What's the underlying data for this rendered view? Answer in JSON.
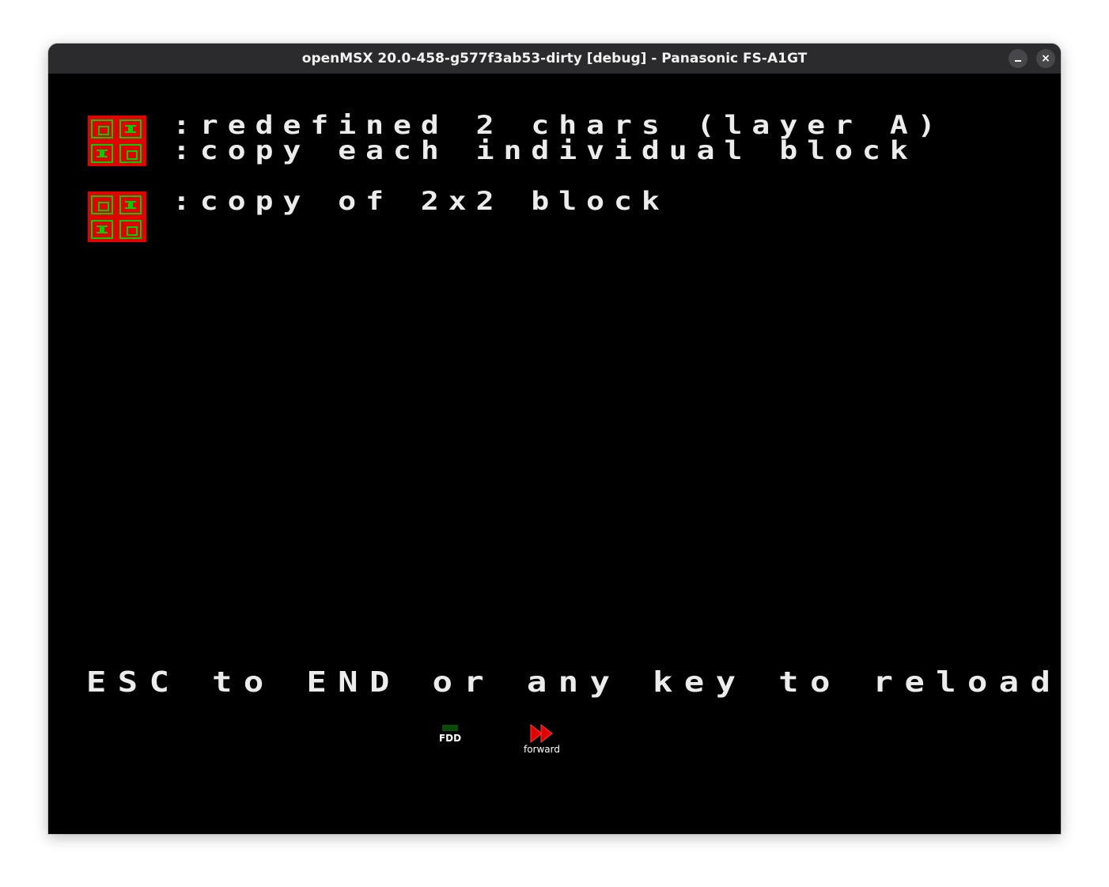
{
  "window": {
    "title": "openMSX 20.0-458-g577f3ab53-dirty [debug] - Panasonic FS-A1GT",
    "minimize_icon": "minimize-icon",
    "close_icon": "close-icon",
    "close_glyph": "×"
  },
  "screen": {
    "lines": [
      ":redefined 2 chars (layer A)",
      ":copy each individual block",
      ":copy of 2x2 block"
    ],
    "footer": "ESC to END or any key to reload.",
    "block_colors": {
      "background": "#e00000",
      "foreground": "#00cc00"
    }
  },
  "indicators": {
    "fdd_label": "FDD",
    "fdd_color": "#0b4a0b",
    "forward_label": "forward",
    "forward_icon": "fast-forward-icon",
    "forward_color": "#e00000"
  }
}
